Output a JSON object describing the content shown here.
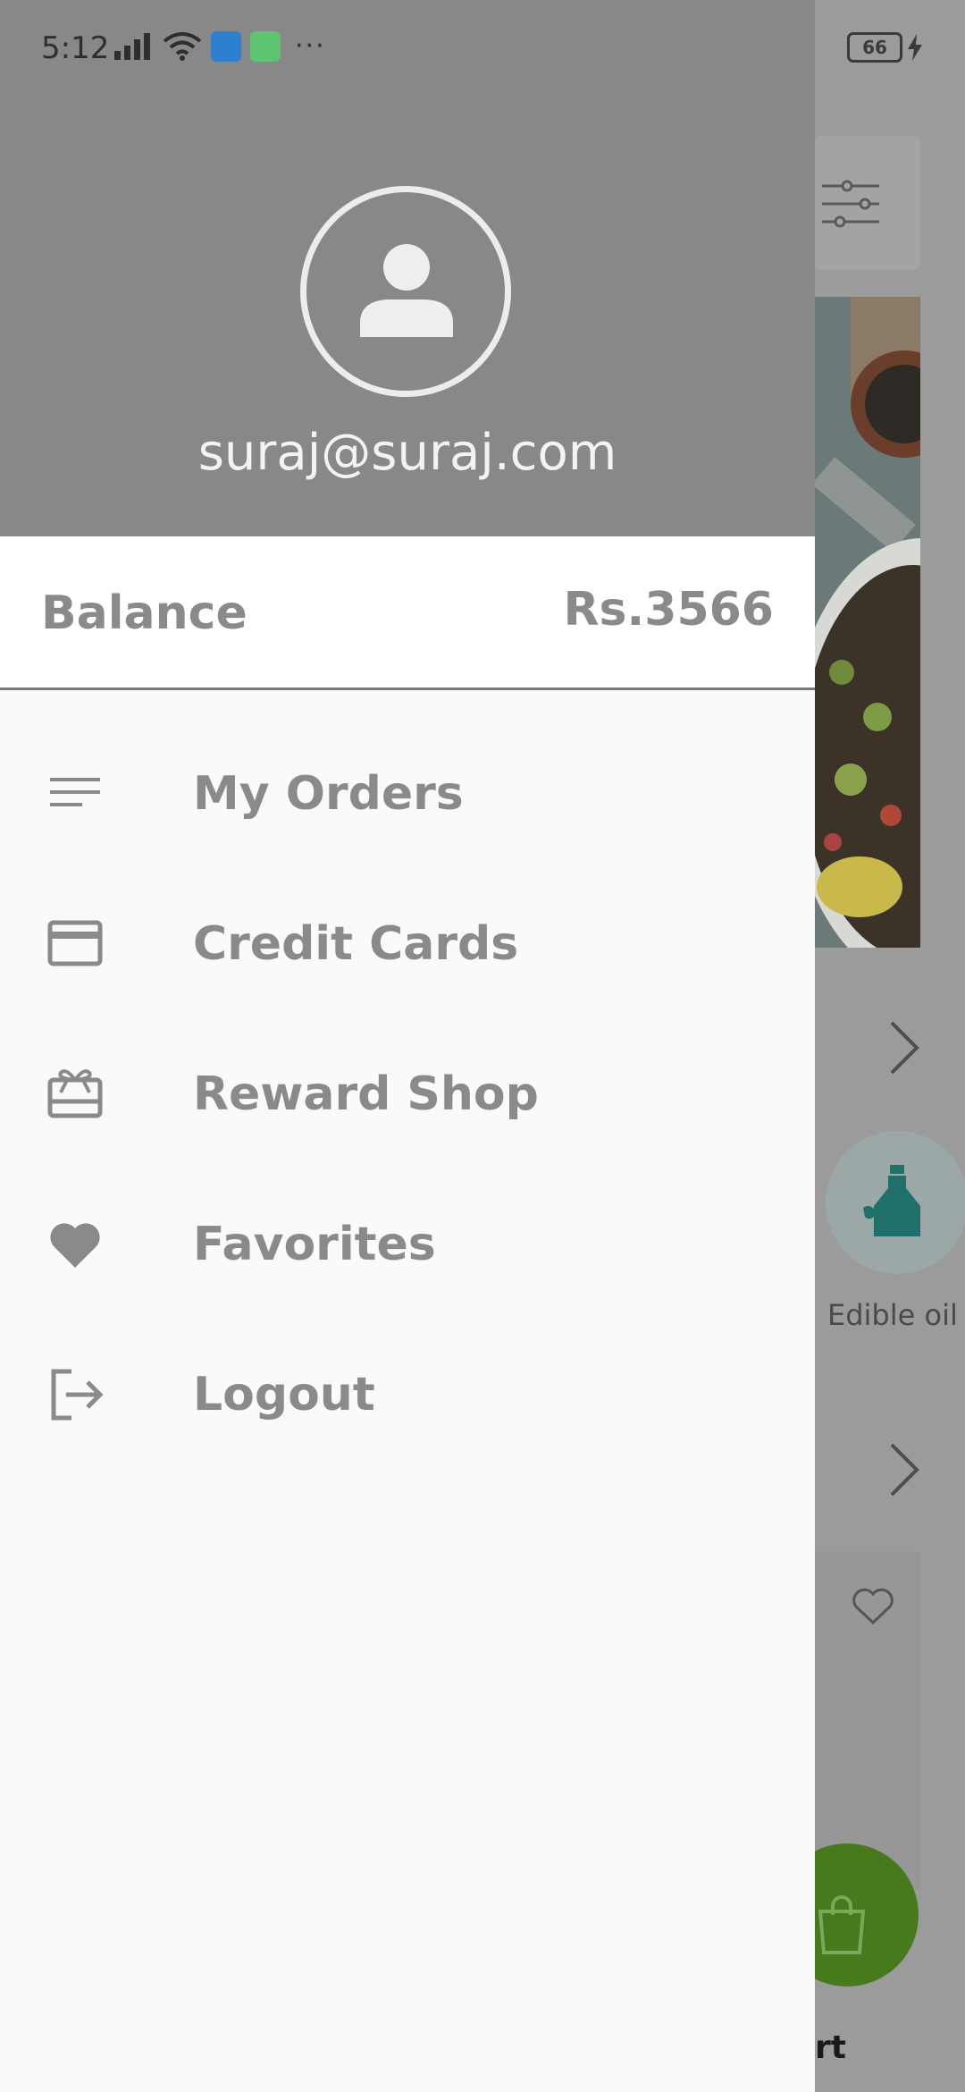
{
  "status_bar": {
    "time": "5:12",
    "battery": "66"
  },
  "drawer": {
    "user": {
      "email": "suraj@suraj.com"
    },
    "balance": {
      "label": "Balance",
      "value": "Rs.3566"
    },
    "menu": [
      {
        "label": "My Orders",
        "icon": "list-icon"
      },
      {
        "label": "Credit Cards",
        "icon": "credit-card-icon"
      },
      {
        "label": "Reward Shop",
        "icon": "gift-card-icon"
      },
      {
        "label": "Favorites",
        "icon": "heart-icon"
      },
      {
        "label": "Logout",
        "icon": "logout-icon"
      }
    ]
  },
  "background": {
    "category_label": "Edible oil",
    "cart_label": "rt"
  },
  "colors": {
    "header_bg": "#888888",
    "menu_text": "#8a8a8a",
    "cart_button": "#467a1c"
  }
}
